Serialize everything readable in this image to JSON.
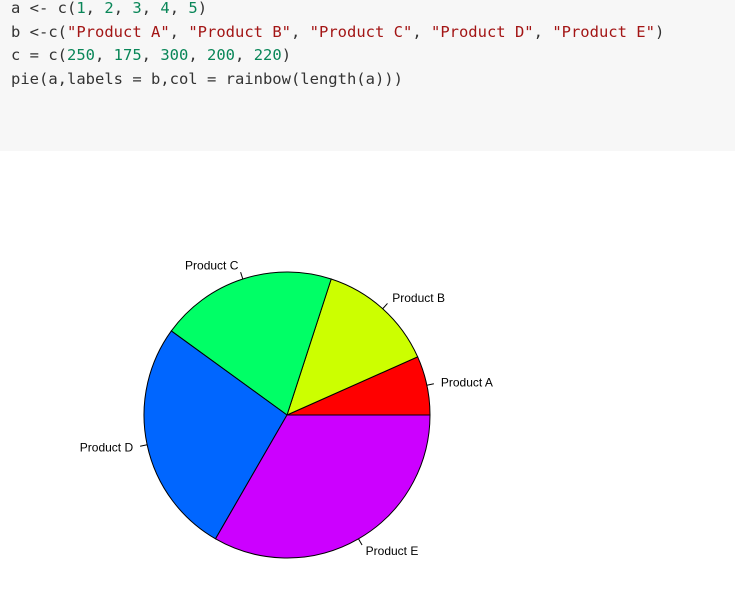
{
  "code": {
    "lines": [
      [
        {
          "t": "plain",
          "v": "a <- c("
        },
        {
          "t": "num",
          "v": "1"
        },
        {
          "t": "plain",
          "v": ", "
        },
        {
          "t": "num",
          "v": "2"
        },
        {
          "t": "plain",
          "v": ", "
        },
        {
          "t": "num",
          "v": "3"
        },
        {
          "t": "plain",
          "v": ", "
        },
        {
          "t": "num",
          "v": "4"
        },
        {
          "t": "plain",
          "v": ", "
        },
        {
          "t": "num",
          "v": "5"
        },
        {
          "t": "plain",
          "v": ")"
        }
      ],
      [
        {
          "t": "plain",
          "v": "b <-c("
        },
        {
          "t": "str",
          "v": "\"Product A\""
        },
        {
          "t": "plain",
          "v": ", "
        },
        {
          "t": "str",
          "v": "\"Product B\""
        },
        {
          "t": "plain",
          "v": ", "
        },
        {
          "t": "str",
          "v": "\"Product C\""
        },
        {
          "t": "plain",
          "v": ", "
        },
        {
          "t": "str",
          "v": "\"Product D\""
        },
        {
          "t": "plain",
          "v": ", "
        },
        {
          "t": "str",
          "v": "\"Product E\""
        },
        {
          "t": "plain",
          "v": ")"
        }
      ],
      [
        {
          "t": "plain",
          "v": "c = c("
        },
        {
          "t": "num",
          "v": "250"
        },
        {
          "t": "plain",
          "v": ", "
        },
        {
          "t": "num",
          "v": "175"
        },
        {
          "t": "plain",
          "v": ", "
        },
        {
          "t": "num",
          "v": "300"
        },
        {
          "t": "plain",
          "v": ", "
        },
        {
          "t": "num",
          "v": "200"
        },
        {
          "t": "plain",
          "v": ", "
        },
        {
          "t": "num",
          "v": "220"
        },
        {
          "t": "plain",
          "v": ")"
        }
      ],
      [
        {
          "t": "plain",
          "v": "pie(a,labels = b,col = rainbow(length(a)))"
        }
      ]
    ]
  },
  "colors": {
    "code_background": "#f7f7f7",
    "number": "#098658",
    "string": "#a31515",
    "plain": "#333333"
  },
  "chart_data": {
    "type": "pie",
    "categories": [
      "Product A",
      "Product B",
      "Product C",
      "Product D",
      "Product E"
    ],
    "values": [
      1,
      2,
      3,
      4,
      5
    ],
    "colors": [
      "#FF0000",
      "#CCFF00",
      "#00FF66",
      "#0066FF",
      "#CC00FF"
    ],
    "start_angle_deg": 0,
    "direction": "counterclockwise",
    "title": "",
    "legend": false
  }
}
